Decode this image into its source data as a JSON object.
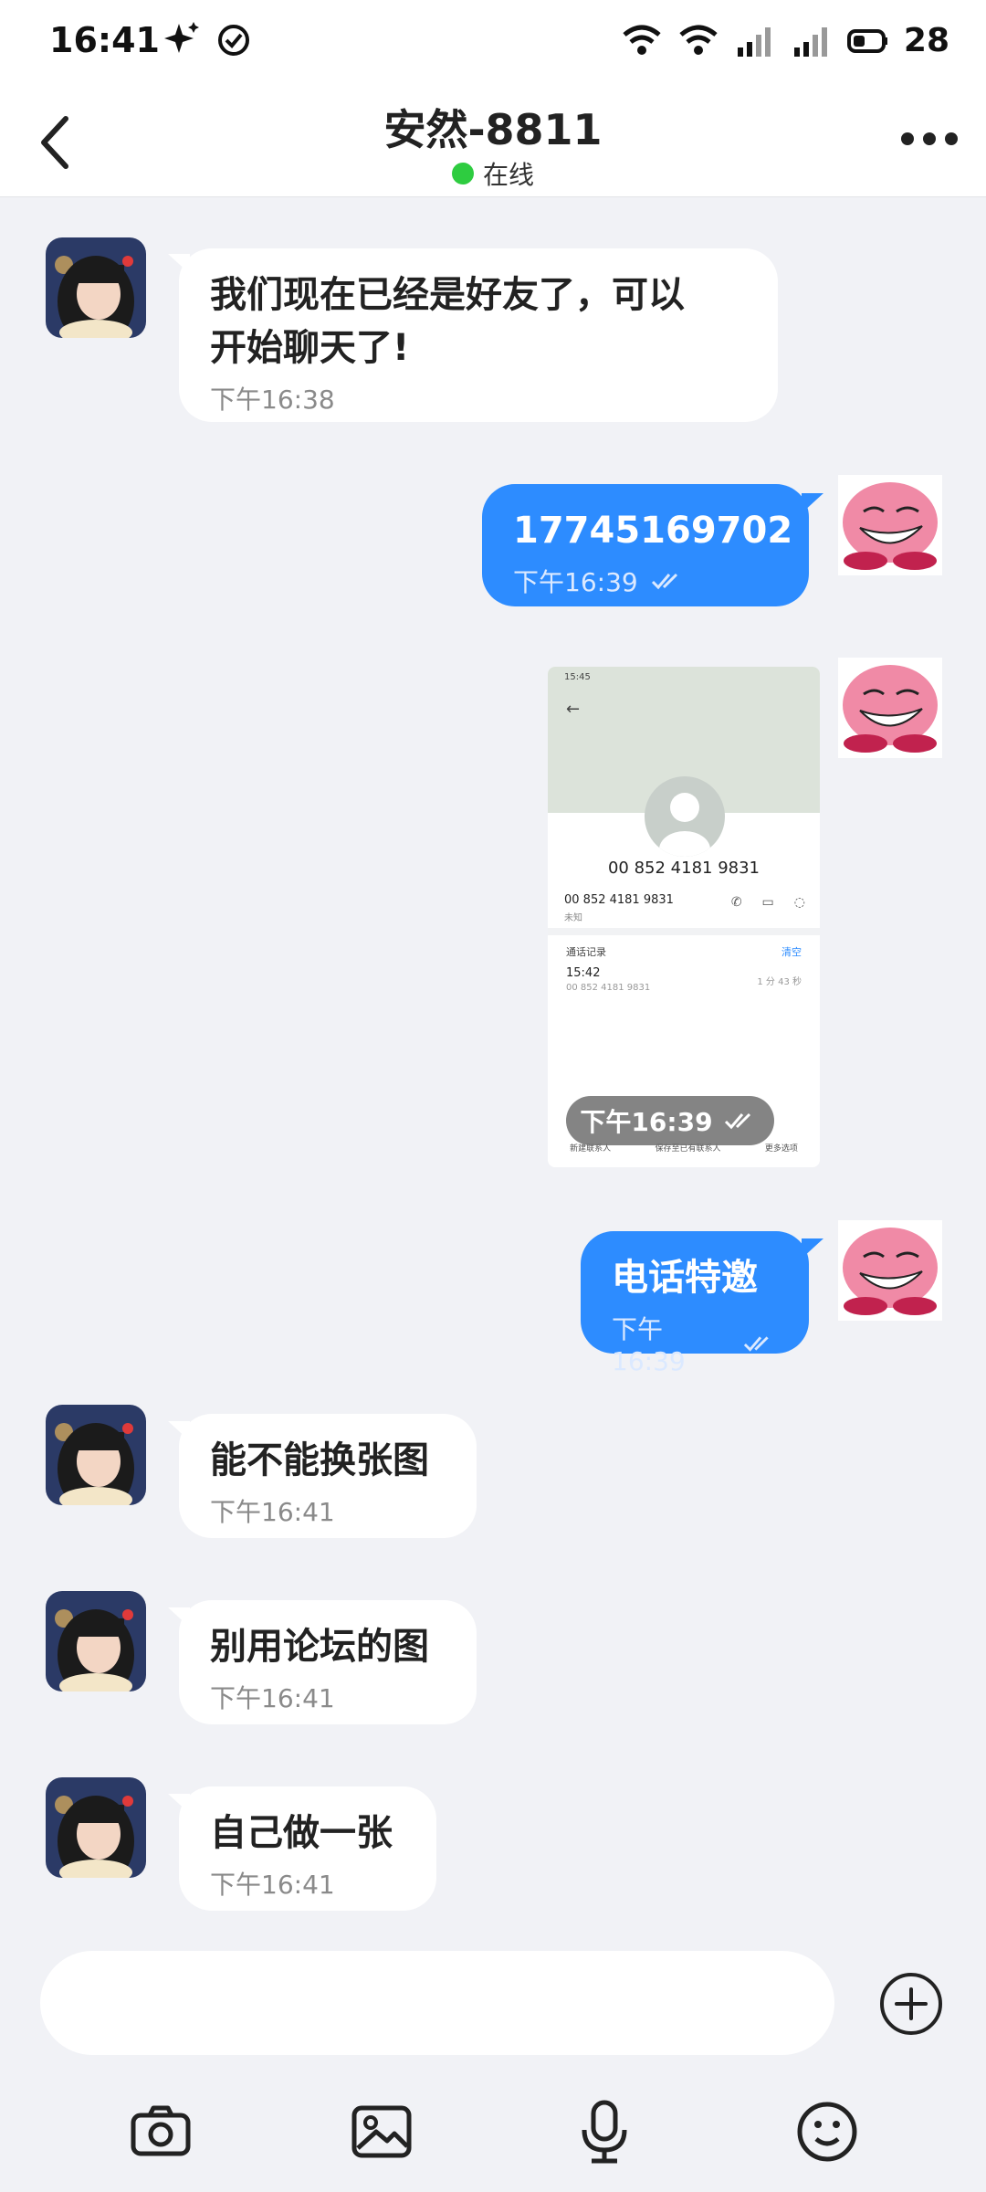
{
  "status_bar": {
    "time": "16:41",
    "battery": "28"
  },
  "header": {
    "title": "安然-8811",
    "presence": "在线"
  },
  "messages": [
    {
      "side": "in",
      "text": "我们现在已经是好友了，可以开始聊天了!",
      "line1": "我们现在已经是好友了，可以",
      "line2": "开始聊天了!",
      "time": "下午16:38"
    },
    {
      "side": "out",
      "text": "17745169702",
      "time": "下午16:39"
    },
    {
      "side": "out",
      "type": "image",
      "time": "下午16:39"
    },
    {
      "side": "out",
      "text": "电话特邀",
      "time": "下午16:39"
    },
    {
      "side": "in",
      "text": "能不能换张图",
      "time": "下午16:41"
    },
    {
      "side": "in",
      "text": "别用论坛的图",
      "time": "下午16:41"
    },
    {
      "side": "in",
      "text": "自己做一张",
      "time": "下午16:41"
    }
  ],
  "screenshot": {
    "status_time": "15:45",
    "phone_number": "00 852 4181 9831",
    "row_number": "00 852 4181 9831",
    "row_sub": "未知",
    "records_label": "通话记录",
    "clear_label": "清空",
    "call_time": "15:42",
    "call_number": "00 852 4181 9831",
    "call_duration": "1 分 43 秒",
    "bottom_new": "新建联系人",
    "bottom_save": "保存至已有联系人",
    "bottom_more": "更多选项"
  },
  "colors": {
    "accent": "#2d8cff",
    "online": "#2ecc40",
    "background": "#f1f2f6"
  },
  "toolbar": {
    "icons": [
      "camera-icon",
      "image-icon",
      "microphone-icon",
      "emoji-icon"
    ]
  }
}
